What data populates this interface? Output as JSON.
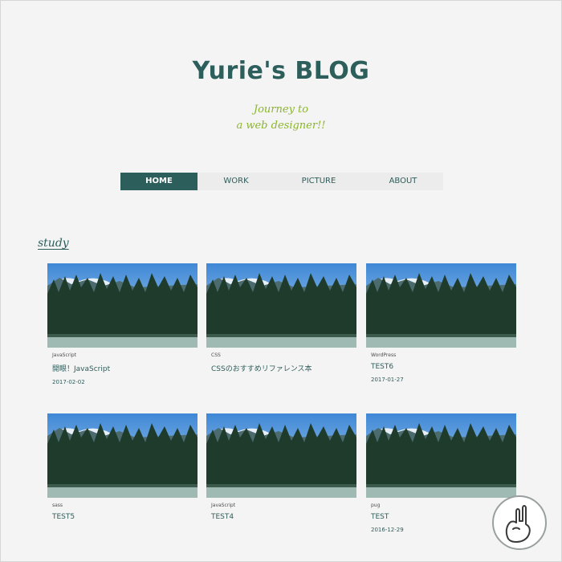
{
  "header": {
    "title": "Yurie's BLOG",
    "tagline_line1": "Journey to",
    "tagline_line2": "a web designer!!"
  },
  "nav": {
    "items": [
      {
        "label": "HOME",
        "active": true
      },
      {
        "label": "WORK",
        "active": false
      },
      {
        "label": "PICTURE",
        "active": false
      },
      {
        "label": "ABOUT",
        "active": false
      }
    ]
  },
  "section": {
    "title": "study"
  },
  "posts": [
    {
      "category": "JavaScript",
      "title": "開眼！JavaScript",
      "date": "2017-02-02"
    },
    {
      "category": "CSS",
      "title": "CSSのおすすめリファレンス本",
      "date": ""
    },
    {
      "category": "WordPress",
      "title": "TEST6",
      "date": "2017-01-27"
    },
    {
      "category": "sass",
      "title": "TEST5",
      "date": ""
    },
    {
      "category": "JavaScript",
      "title": "TEST4",
      "date": ""
    },
    {
      "category": "pug",
      "title": "TEST",
      "date": "2016-12-29"
    }
  ],
  "colors": {
    "brand": "#2c5e5b",
    "accent": "#8bb52d",
    "background": "#f4f4f4"
  },
  "icons": {
    "badge": "rock-hand-icon"
  }
}
